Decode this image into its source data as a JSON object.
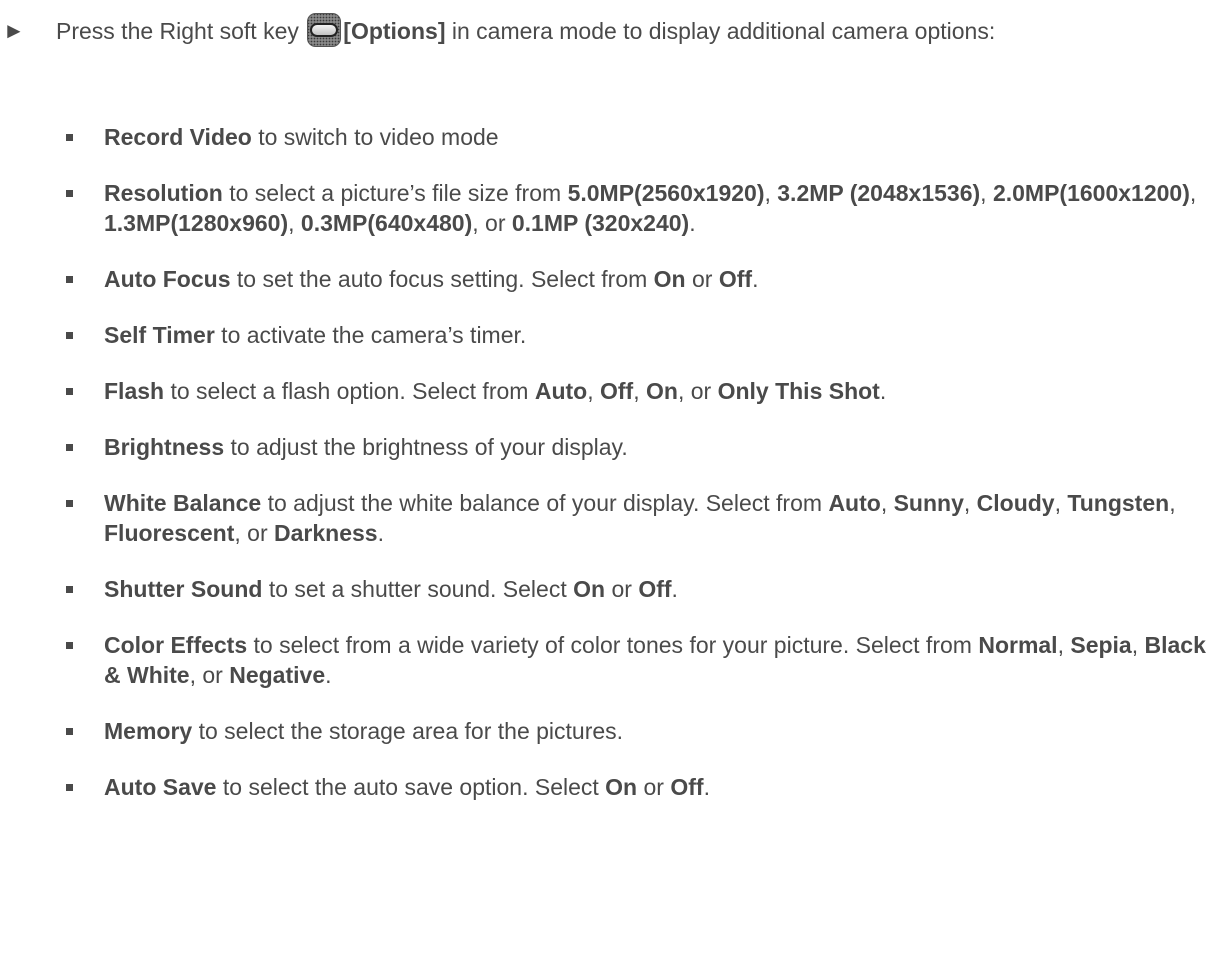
{
  "intro": {
    "t0": "Press the Right soft key ",
    "key_label": "[Options]",
    "t1": " in camera mode to display additional camera options:",
    "key_icon": "right-soft-key-icon"
  },
  "options": [
    {
      "title": "Record Video",
      "desc": " to switch to video mode"
    },
    {
      "title": "Resolution",
      "desc": " to select a picture’s file size from ",
      "choices": [
        "5.0MP(2560x1920)",
        "3.2MP (2048x1536)",
        "2.0MP(1600x1200)",
        "1.3MP(1280x960)",
        "0.3MP(640x480)",
        "0.1MP (320x240)"
      ],
      "or": "or"
    },
    {
      "title": "Auto Focus",
      "desc": " to set the auto focus setting. Select from ",
      "choices": [
        "On",
        "Off"
      ],
      "or": "or"
    },
    {
      "title": "Self Timer",
      "desc": " to activate the camera’s timer."
    },
    {
      "title": "Flash",
      "desc": " to select a flash option.  Select from ",
      "choices": [
        "Auto",
        "Off",
        "On",
        "Only This Shot"
      ],
      "or": "or"
    },
    {
      "title": "Brightness",
      "desc": " to adjust the brightness of your display."
    },
    {
      "title": "White Balance",
      "desc": " to adjust the white balance of your display. Select from ",
      "choices": [
        "Auto",
        "Sunny",
        "Cloudy",
        "Tungsten",
        "Fluorescent",
        "Darkness"
      ],
      "or": "or"
    },
    {
      "title": "Shutter Sound",
      "desc": " to set a shutter sound. Select ",
      "choices": [
        "On",
        "Off"
      ],
      "or": "or"
    },
    {
      "title": "Color Effects",
      "desc": " to select from a wide variety of color tones for your picture. Select from ",
      "choices": [
        "Normal",
        "Sepia",
        "Black & White",
        "Negative"
      ],
      "or": "or"
    },
    {
      "title": "Memory",
      "desc": " to select the storage area for the pictures."
    },
    {
      "title": "Auto Save",
      "desc": " to select the auto save option. Select ",
      "choices": [
        "On",
        "Off"
      ],
      "or": "or"
    }
  ]
}
